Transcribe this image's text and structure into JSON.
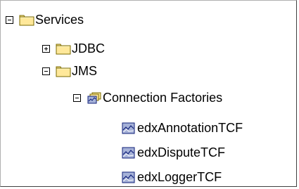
{
  "tree": {
    "root": {
      "label": "Services",
      "icon": "folder-icon",
      "expanded": true
    },
    "jdbc": {
      "label": "JDBC",
      "icon": "folder-icon",
      "expanded": false
    },
    "jms": {
      "label": "JMS",
      "icon": "folder-icon",
      "expanded": true
    },
    "connection_factories": {
      "label": "Connection Factories",
      "icon": "stacked-folder-icon",
      "expanded": true
    },
    "leaves": [
      {
        "label": "edxAnnotationTCF",
        "icon": "factory-item-icon"
      },
      {
        "label": "edxDisputeTCF",
        "icon": "factory-item-icon"
      },
      {
        "label": "edxLoggerTCF",
        "icon": "factory-item-icon"
      }
    ]
  },
  "colors": {
    "folder_fill": "#ffe89a",
    "folder_border": "#7a6a00",
    "item_fill": "#a6b2d8",
    "item_border": "#10207a"
  }
}
